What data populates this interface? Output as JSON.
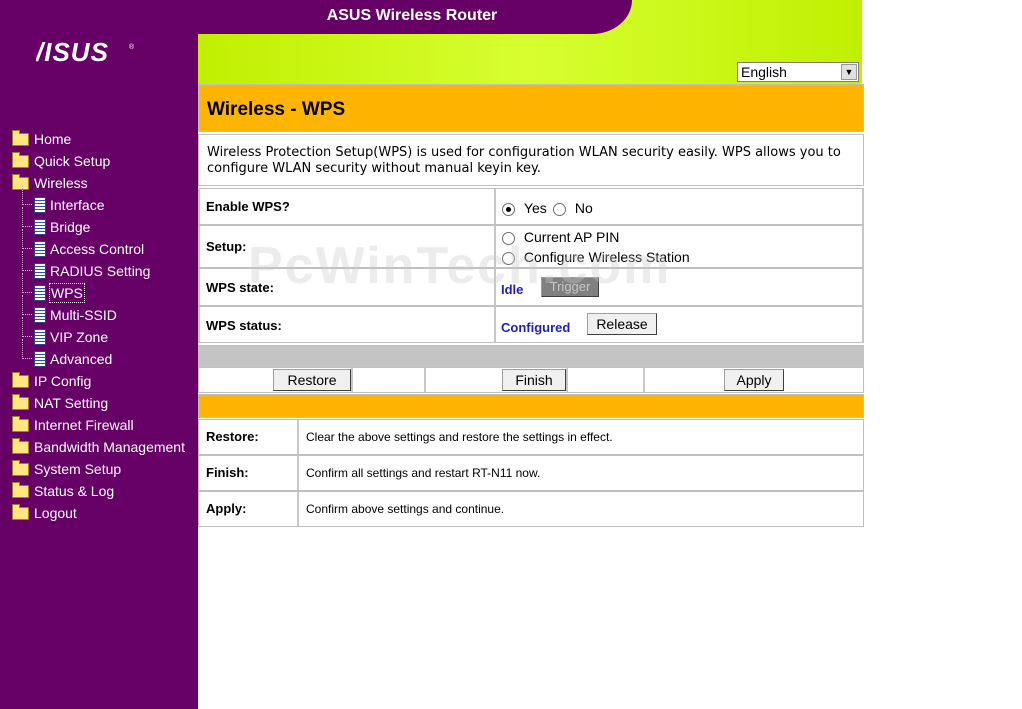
{
  "header": {
    "title": "ASUS Wireless Router",
    "logo_text": "/ISUS",
    "language": "English"
  },
  "sidebar": {
    "items": [
      {
        "label": "Home"
      },
      {
        "label": "Quick Setup"
      },
      {
        "label": "Wireless"
      },
      {
        "label": "IP Config"
      },
      {
        "label": "NAT Setting"
      },
      {
        "label": "Internet Firewall"
      },
      {
        "label": "Bandwidth Management"
      },
      {
        "label": "System Setup"
      },
      {
        "label": "Status & Log"
      },
      {
        "label": "Logout"
      }
    ],
    "wireless_sub": [
      {
        "label": "Interface"
      },
      {
        "label": "Bridge"
      },
      {
        "label": "Access Control"
      },
      {
        "label": "RADIUS Setting"
      },
      {
        "label": "WPS"
      },
      {
        "label": "Multi-SSID"
      },
      {
        "label": "VIP Zone"
      },
      {
        "label": "Advanced"
      }
    ]
  },
  "page": {
    "title": "Wireless - WPS",
    "description": "Wireless Protection Setup(WPS) is used for configuration WLAN security easily. WPS allows you to configure WLAN security without manual keyin key."
  },
  "form": {
    "enable_label": "Enable WPS?",
    "enable_yes": "Yes",
    "enable_no": "No",
    "enable_value": "Yes",
    "setup_label": "Setup:",
    "setup_opt1": "Current AP PIN",
    "setup_opt2": "Configure Wireless Station",
    "state_label": "WPS state:",
    "state_value": "Idle",
    "trigger_label": "Trigger",
    "status_label": "WPS status:",
    "status_value": "Configured",
    "release_label": "Release"
  },
  "actions": {
    "restore": "Restore",
    "finish": "Finish",
    "apply": "Apply"
  },
  "help": [
    {
      "key": "Restore:",
      "text": "Clear the above settings and restore the settings in effect."
    },
    {
      "key": "Finish:",
      "text": "Confirm all settings and restart RT-N11 now."
    },
    {
      "key": "Apply:",
      "text": "Confirm above settings and continue."
    }
  ],
  "watermark": "PcWinTech.com",
  "colors": {
    "sidebar": "#660066",
    "header_green": "#ccff00",
    "title_orange": "#ffb400",
    "status_blue": "#2020c0"
  }
}
